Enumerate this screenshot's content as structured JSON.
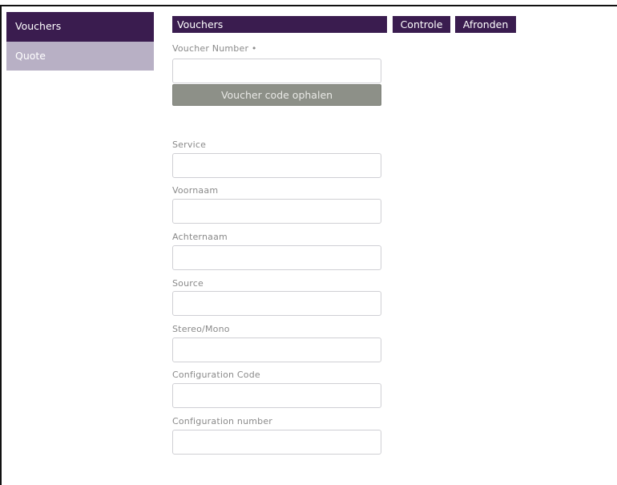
{
  "sidebar": {
    "items": [
      {
        "label": "Vouchers",
        "active": true
      },
      {
        "label": "Quote",
        "active": false
      }
    ]
  },
  "topbar": {
    "title": "Vouchers",
    "controle_label": "Controle",
    "afronden_label": "Afronden"
  },
  "form": {
    "voucher_number_label": "Voucher Number •",
    "voucher_number_value": "",
    "fetch_button_label": "Voucher code ophalen",
    "fields": [
      {
        "label": "Service",
        "value": ""
      },
      {
        "label": "Voornaam",
        "value": ""
      },
      {
        "label": "Achternaam",
        "value": ""
      },
      {
        "label": "Source",
        "value": ""
      },
      {
        "label": "Stereo/Mono",
        "value": ""
      },
      {
        "label": "Configuration Code",
        "value": ""
      },
      {
        "label": "Configuration number",
        "value": ""
      }
    ]
  },
  "colors": {
    "accent": "#3a1c4f",
    "sidebar_inactive": "#b8b0c5",
    "button_disabled": "#8d9088",
    "label_gray": "#8a8a8a"
  }
}
